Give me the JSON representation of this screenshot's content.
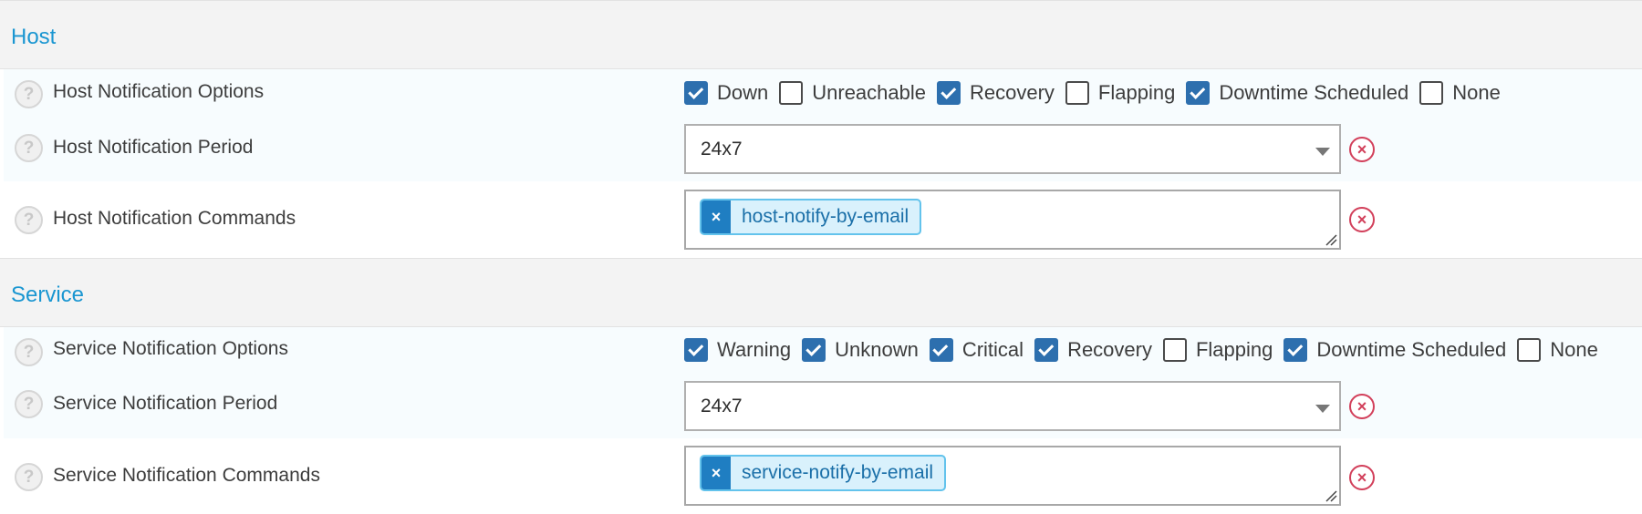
{
  "host": {
    "title": "Host",
    "options": {
      "label": "Host Notification Options",
      "items": [
        {
          "label": "Down",
          "checked": true
        },
        {
          "label": "Unreachable",
          "checked": false
        },
        {
          "label": "Recovery",
          "checked": true
        },
        {
          "label": "Flapping",
          "checked": false
        },
        {
          "label": "Downtime Scheduled",
          "checked": true
        },
        {
          "label": "None",
          "checked": false
        }
      ]
    },
    "period": {
      "label": "Host Notification Period",
      "value": "24x7"
    },
    "commands": {
      "label": "Host Notification Commands",
      "tags": [
        "host-notify-by-email"
      ]
    }
  },
  "service": {
    "title": "Service",
    "options": {
      "label": "Service Notification Options",
      "items": [
        {
          "label": "Warning",
          "checked": true
        },
        {
          "label": "Unknown",
          "checked": true
        },
        {
          "label": "Critical",
          "checked": true
        },
        {
          "label": "Recovery",
          "checked": true
        },
        {
          "label": "Flapping",
          "checked": false
        },
        {
          "label": "Downtime Scheduled",
          "checked": true
        },
        {
          "label": "None",
          "checked": false
        }
      ]
    },
    "period": {
      "label": "Service Notification Period",
      "value": "24x7"
    },
    "commands": {
      "label": "Service Notification Commands",
      "tags": [
        "service-notify-by-email"
      ]
    }
  },
  "icons": {
    "help": "?",
    "clear": "×",
    "remove_tag": "×"
  },
  "colors": {
    "accent": "#1a96d1",
    "checkbox": "#2d6fae",
    "tag_bg": "#d9f1fc",
    "tag_remove": "#1f7ec2",
    "clear": "#d23f5a"
  }
}
